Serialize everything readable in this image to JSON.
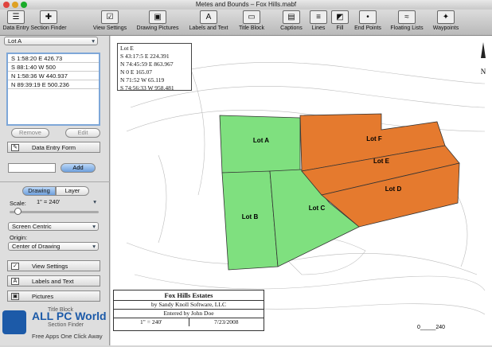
{
  "window": {
    "title": "Metes and Bounds – Fox Hills.mabf"
  },
  "toolbar": {
    "items": [
      {
        "label": "Data Entry",
        "icon": "data-entry-icon",
        "glyph": "☰"
      },
      {
        "label": "Section Finder",
        "icon": "section-finder-icon",
        "glyph": "✚"
      },
      {
        "label": "View Settings",
        "icon": "view-settings-icon",
        "glyph": "☑"
      },
      {
        "label": "Drawing Pictures",
        "icon": "picture-icon",
        "glyph": "▣"
      },
      {
        "label": "Labels and Text",
        "icon": "text-icon",
        "glyph": "A"
      },
      {
        "label": "Title Block",
        "icon": "title-block-icon",
        "glyph": "▭"
      },
      {
        "label": "Captions",
        "icon": "captions-icon",
        "glyph": "▤"
      },
      {
        "label": "Lines",
        "icon": "lines-icon",
        "glyph": "≡"
      },
      {
        "label": "Fill",
        "icon": "fill-icon",
        "glyph": "◩"
      },
      {
        "label": "End Points",
        "icon": "end-points-icon",
        "glyph": "•"
      },
      {
        "label": "Floating Lists",
        "icon": "floating-lists-icon",
        "glyph": "≈"
      },
      {
        "label": "Waypoints",
        "icon": "waypoints-icon",
        "glyph": "✦"
      }
    ]
  },
  "sidebar": {
    "lot_select": "Lot A",
    "calls": [
      "S 1:58:20 E 426.73",
      "S 88:1:40 W 500",
      "N 1:58:36 W 440.937",
      "N 89:39:19 E 500.236"
    ],
    "remove": "Remove",
    "edit": "Edit",
    "data_entry_form": "Data Entry Form",
    "add": "Add",
    "tab_drawing": "Drawing",
    "tab_layer": "Layer",
    "scale_label": "Scale:",
    "scale_value": "1\" = 240'",
    "view_select": "Screen Centric",
    "origin_label": "Origin:",
    "origin_select": "Center of Drawing",
    "view_settings": "View Settings",
    "labels_text": "Labels and Text",
    "pictures": "Pictures",
    "title_block": "Title Block",
    "section_finder": "Section Finder"
  },
  "drawing": {
    "legend_title": "Lot E",
    "legend_calls": [
      "S 43:17:5 E 224.391",
      "N 74:45:59 E 863.967",
      "N 0 E 165.07",
      "N 71:52 W 65.119",
      "S 74:56:33 W 958.481"
    ],
    "lots": [
      {
        "name": "Lot A",
        "color": "#7fe07f"
      },
      {
        "name": "Lot B",
        "color": "#7fe07f"
      },
      {
        "name": "Lot C",
        "color": "#7fe07f"
      },
      {
        "name": "Lot F",
        "color": "#e57a2e"
      },
      {
        "name": "Lot E",
        "color": "#e57a2e"
      },
      {
        "name": "Lot D",
        "color": "#e57a2e"
      }
    ],
    "north": "N",
    "scale_bar": "0_____240",
    "title_block": {
      "title": "Fox Hills Estates",
      "by": "by Sandy Knoll Software, LLC",
      "entered": "Entered by John Doe",
      "scale": "1\" = 240'",
      "date": "7/23/2008"
    }
  },
  "watermark": {
    "brand": "ALL PC World",
    "tagline": "Free Apps One Click Away"
  }
}
